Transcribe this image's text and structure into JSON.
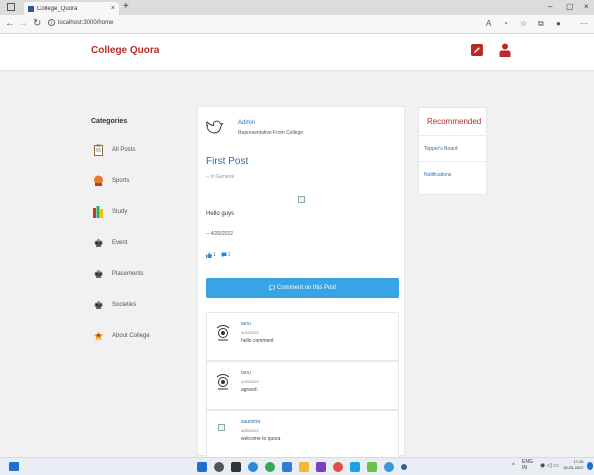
{
  "browser": {
    "tab_title": "College_Quora",
    "tab_close": "×",
    "new_tab": "+",
    "url": "localhost:3000/home",
    "minimize": "–",
    "maximize": "▢",
    "close": "×"
  },
  "header": {
    "brand": "College Quora"
  },
  "sidebar": {
    "title": "Categories",
    "items": [
      {
        "label": "All Posts",
        "icon": "clipboard-icon"
      },
      {
        "label": "Sports",
        "icon": "basketball-icon"
      },
      {
        "label": "Study",
        "icon": "books-icon"
      },
      {
        "label": "Event",
        "icon": "chess-king-icon"
      },
      {
        "label": "Placements",
        "icon": "chess-king-icon"
      },
      {
        "label": "Societies",
        "icon": "chess-king-icon"
      },
      {
        "label": "About College",
        "icon": "star-badge-icon"
      }
    ]
  },
  "post": {
    "author": "Admin",
    "author_desc": "Representative From College",
    "title": "First Post",
    "category": "-- In General",
    "body": "Hello guys",
    "date": "-- 4/20/2022",
    "likes": "1",
    "comments_count": "1",
    "comment_button": "Comment on this Post"
  },
  "comments": [
    {
      "name": "tanu",
      "date": "4/20/2022",
      "text": "hello comment"
    },
    {
      "name": "tanu",
      "date": "4/20/2022",
      "text": "agreed."
    },
    {
      "name": "saumitra",
      "date": "4/25/2022",
      "text": "welcome to quora"
    }
  ],
  "recommended": {
    "title": "Recommended",
    "items": [
      "Topper's Board",
      "Notifications"
    ]
  },
  "taskbar": {
    "lang_top": "ENG",
    "lang_bottom": "IN",
    "time": "17:45",
    "date": "18-05-2022"
  },
  "colors": {
    "brand": "#b92b27",
    "link": "#2b6dad",
    "button": "#3aa3e3"
  }
}
